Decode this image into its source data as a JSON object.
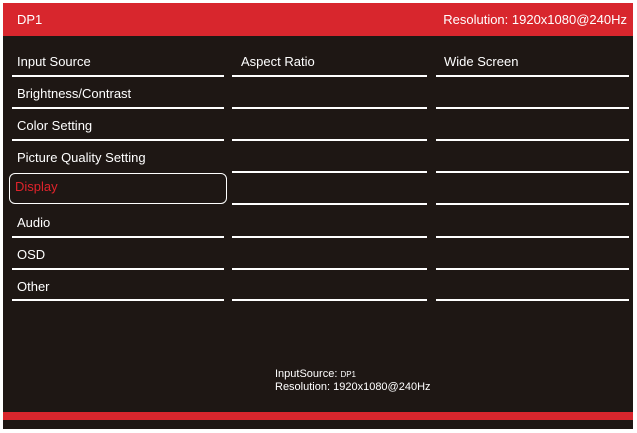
{
  "header": {
    "source": "DP1",
    "resolution": "Resolution: 1920x1080@240Hz"
  },
  "menu": {
    "items": [
      {
        "label": "Input Source"
      },
      {
        "label": "Brightness/Contrast"
      },
      {
        "label": "Color Setting"
      },
      {
        "label": "Picture Quality Setting"
      },
      {
        "label": "Display",
        "selected": true
      },
      {
        "label": "Audio"
      },
      {
        "label": "OSD"
      },
      {
        "label": "Other"
      }
    ]
  },
  "submenu": {
    "label": "Aspect Ratio",
    "value": "Wide Screen"
  },
  "footer": {
    "input_source_label": "InputSource:",
    "input_source_value": "DP1",
    "resolution_label": "Resolution:",
    "resolution_value": "1920x1080@240Hz"
  },
  "colors": {
    "accent": "#d8262d",
    "background": "#1e1714",
    "selected_text": "#e0232b",
    "text": "#ffffff"
  }
}
